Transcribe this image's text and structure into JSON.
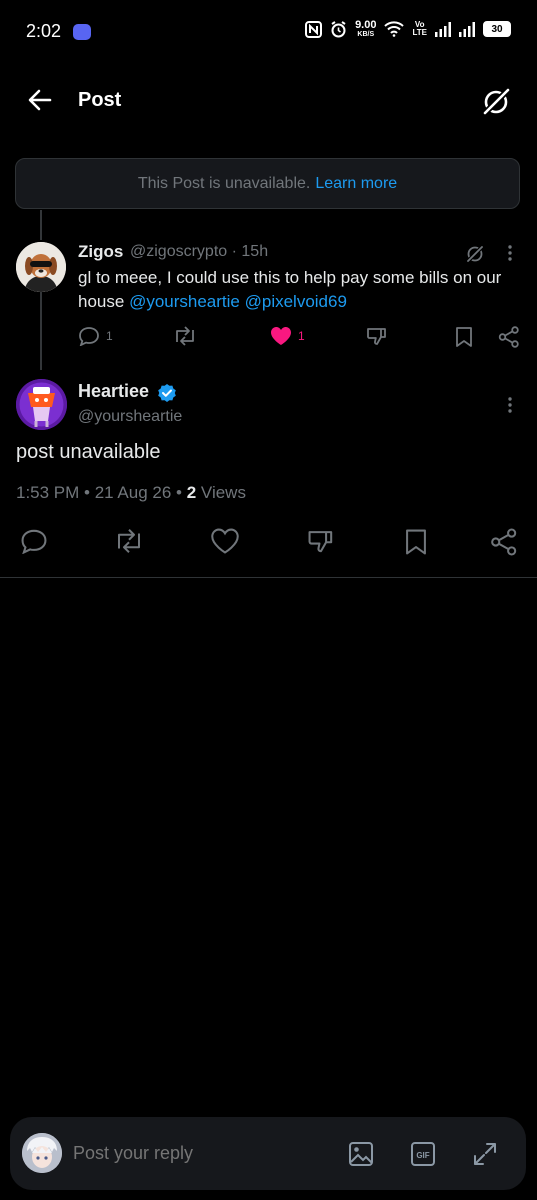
{
  "status_bar": {
    "time": "2:02",
    "speed_value": "9.00",
    "speed_unit": "KB/S",
    "volte_top": "Vo",
    "volte_bottom": "LTE",
    "battery": "30"
  },
  "header": {
    "title": "Post"
  },
  "banner": {
    "text": "This Post is unavailable.",
    "link": "Learn more"
  },
  "reply_tweet": {
    "name": "Zigos",
    "handle": "@zigoscrypto",
    "time": "· 15h",
    "text": "gl to meee, I could use this to help pay some bills on our house",
    "mention1": "@yoursheartie",
    "mention2": "@pixelvoid69",
    "reply_count": "1",
    "like_count": "1"
  },
  "main_post": {
    "name": "Heartiee",
    "handle": "@yoursheartie",
    "text": "post unavailable",
    "timestamp": "1:53 PM • 21 Aug 26 •",
    "views_count": "2",
    "views_label": "Views"
  },
  "reply_bar": {
    "placeholder": "Post your reply"
  },
  "colors": {
    "accent": "#1d9bf0",
    "like": "#f91880",
    "muted": "#71767b"
  },
  "icons": [
    "back-arrow-icon",
    "grok-icon",
    "reply-icon",
    "repost-icon",
    "like-icon",
    "dislike-icon",
    "bookmark-icon",
    "share-icon",
    "more-icon",
    "verified-icon",
    "image-icon",
    "gif-icon",
    "expand-icon"
  ]
}
